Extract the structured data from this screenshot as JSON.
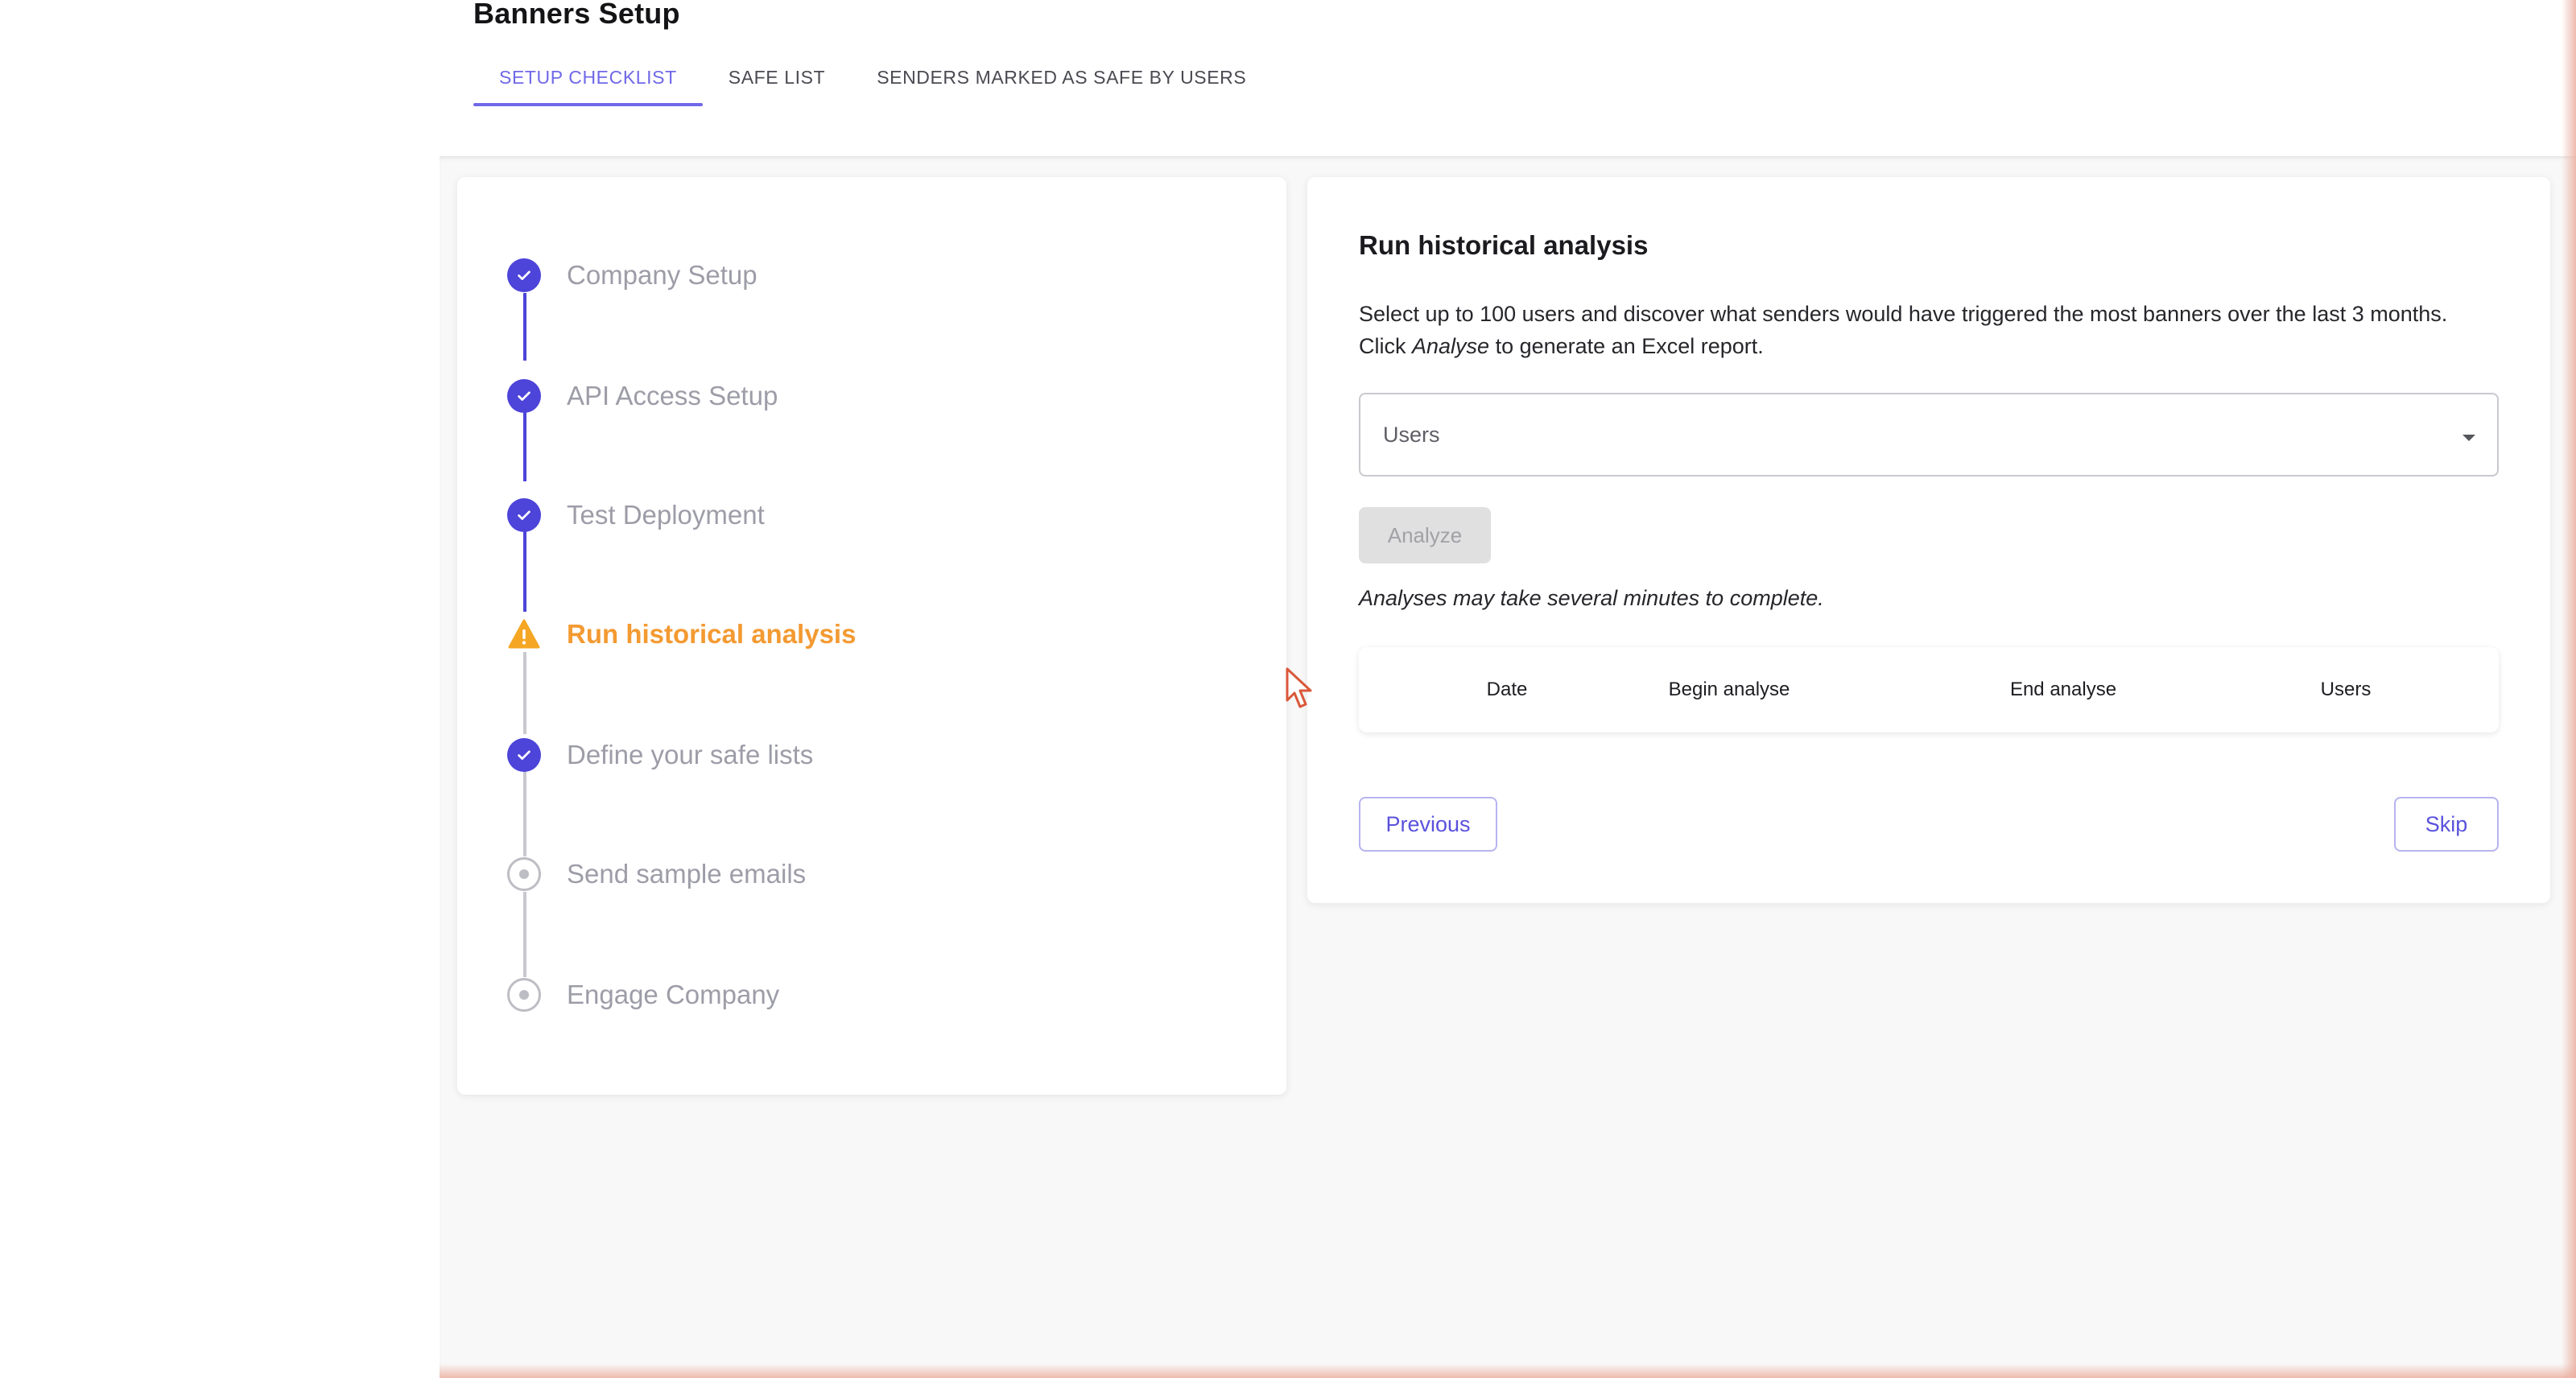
{
  "page": {
    "title": "Banners Setup"
  },
  "tabs": [
    {
      "label": "SETUP CHECKLIST",
      "active": true
    },
    {
      "label": "SAFE LIST",
      "active": false
    },
    {
      "label": "SENDERS MARKED AS SAFE BY USERS",
      "active": false
    }
  ],
  "steps": [
    {
      "label": "Company Setup",
      "status": "done",
      "icon": "check-icon"
    },
    {
      "label": "API Access Setup",
      "status": "done",
      "icon": "check-icon"
    },
    {
      "label": "Test Deployment",
      "status": "done",
      "icon": "check-icon"
    },
    {
      "label": "Run historical analysis",
      "status": "current",
      "icon": "warning-icon"
    },
    {
      "label": "Define your safe lists",
      "status": "done",
      "icon": "check-icon"
    },
    {
      "label": "Send sample emails",
      "status": "todo",
      "icon": "radio-dot-icon"
    },
    {
      "label": "Engage Company",
      "status": "todo",
      "icon": "radio-dot-icon"
    }
  ],
  "panel": {
    "title": "Run historical analysis",
    "description_line1": "Select up to 100 users and discover what senders would have triggered the most banners over the last 3 months.",
    "description_click": "Click ",
    "description_em": "Analyse",
    "description_rest": " to generate an Excel report.",
    "users_select_placeholder": "Users",
    "analyze_label": "Analyze",
    "note": "Analyses may take several minutes to complete.",
    "table_headers": [
      "Date",
      "Begin analyse",
      "End analyse",
      "Users"
    ],
    "previous_label": "Previous",
    "skip_label": "Skip"
  },
  "colors": {
    "accent": "#4d44d9",
    "tab_active": "#6f68e8",
    "warning": "#f39a32",
    "muted": "#9d9da8"
  }
}
